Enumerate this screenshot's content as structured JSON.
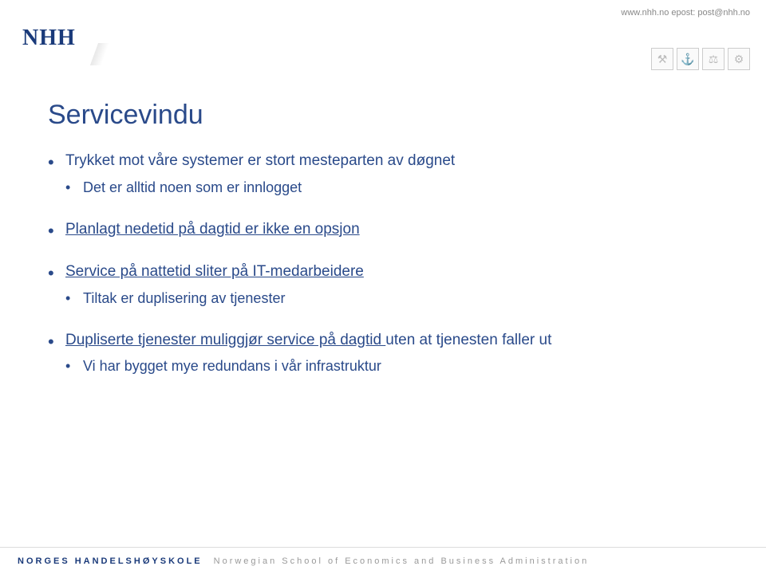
{
  "header": {
    "url_text": "www.nhh.no epost: post@nhh.no",
    "logo": "NHH"
  },
  "icons": {
    "hammers": "⚒",
    "anchor": "⚓",
    "scales": "⚖",
    "gear": "⚙"
  },
  "content": {
    "title": "Servicevindu",
    "bullets": [
      {
        "text": "Trykket mot våre systemer er stort mesteparten av døgnet",
        "underline": false,
        "sub": [
          {
            "text": "Det er alltid noen som er innlogget"
          }
        ]
      },
      {
        "text": "Planlagt nedetid på dagtid er ikke en opsjon",
        "underline": true,
        "sub": []
      },
      {
        "text": "Service på nattetid sliter på IT-medarbeidere",
        "underline": true,
        "sub": [
          {
            "text": "Tiltak er duplisering av tjenester"
          }
        ]
      },
      {
        "text_pre": "Dupliserte tjenester muliggjør service på dagtid ",
        "text_post": "uten at tjenesten faller ut",
        "underline": true,
        "sub": [
          {
            "text": "Vi har bygget mye redundans i vår infrastruktur"
          }
        ]
      }
    ]
  },
  "footer": {
    "left": "NORGES HANDELSHØYSKOLE",
    "right": "Norwegian School of Economics and Business Administration"
  }
}
